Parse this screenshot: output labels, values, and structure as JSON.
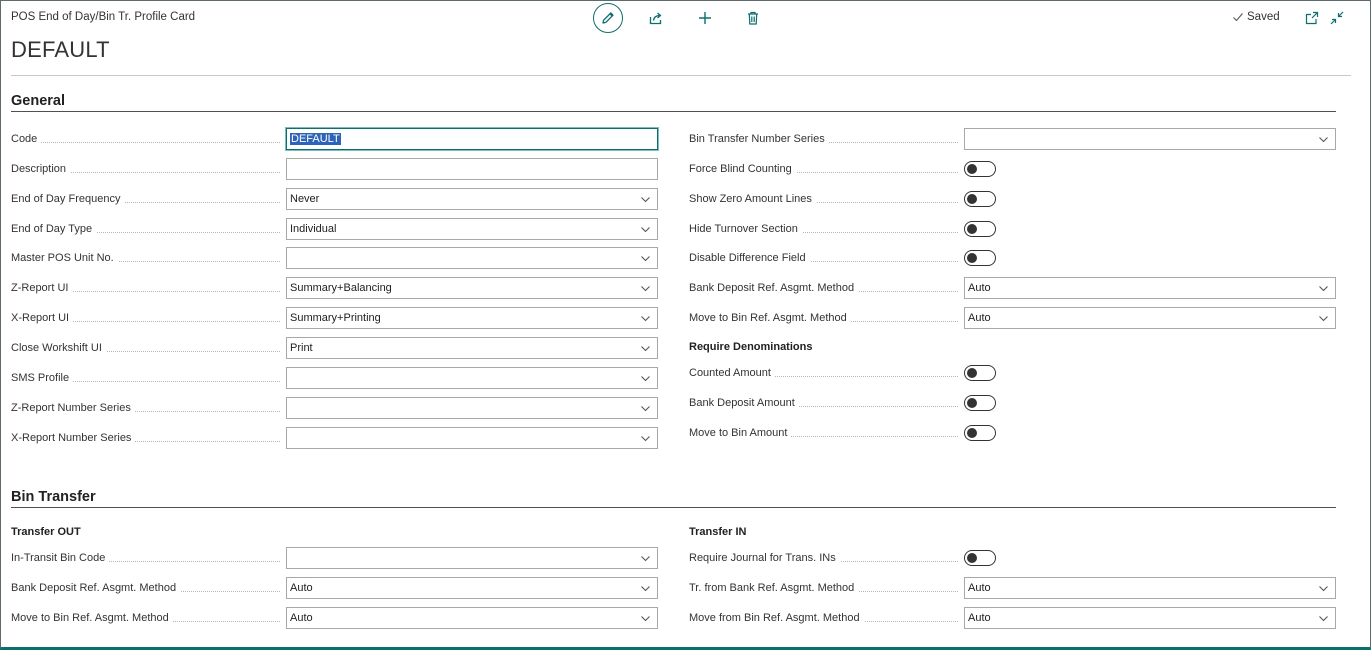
{
  "header": {
    "breadcrumb": "POS End of Day/Bin Tr. Profile Card",
    "title": "DEFAULT",
    "status": "Saved",
    "icon_color": "#0d6e6e"
  },
  "general": {
    "section_title": "General",
    "left": [
      {
        "label": "Code",
        "value": "DEFAULT",
        "kind": "text"
      },
      {
        "label": "Description",
        "value": "",
        "kind": "text"
      },
      {
        "label": "End of Day Frequency",
        "value": "Never",
        "kind": "select"
      },
      {
        "label": "End of Day Type",
        "value": "Individual",
        "kind": "select"
      },
      {
        "label": "Master POS Unit No.",
        "value": "",
        "kind": "select"
      },
      {
        "label": "Z-Report UI",
        "value": "Summary+Balancing",
        "kind": "select"
      },
      {
        "label": "X-Report UI",
        "value": "Summary+Printing",
        "kind": "select"
      },
      {
        "label": "Close Workshift UI",
        "value": "Print",
        "kind": "select"
      },
      {
        "label": "SMS Profile",
        "value": "",
        "kind": "select"
      },
      {
        "label": "Z-Report Number Series",
        "value": "",
        "kind": "select"
      },
      {
        "label": "X-Report Number Series",
        "value": "",
        "kind": "select"
      }
    ],
    "right": [
      {
        "label": "Bin Transfer Number Series",
        "value": "",
        "kind": "select"
      },
      {
        "label": "Force Blind Counting",
        "value": "off",
        "kind": "toggle"
      },
      {
        "label": "Show Zero Amount Lines",
        "value": "off",
        "kind": "toggle"
      },
      {
        "label": "Hide Turnover Section",
        "value": "off",
        "kind": "toggle"
      },
      {
        "label": "Disable Difference Field",
        "value": "off",
        "kind": "toggle"
      },
      {
        "label": "Bank Deposit Ref. Asgmt. Method",
        "value": "Auto",
        "kind": "select"
      },
      {
        "label": "Move to Bin Ref. Asgmt. Method",
        "value": "Auto",
        "kind": "select"
      }
    ],
    "denominations_title": "Require Denominations",
    "denominations": [
      {
        "label": "Counted Amount",
        "value": "off",
        "kind": "toggle"
      },
      {
        "label": "Bank Deposit Amount",
        "value": "off",
        "kind": "toggle"
      },
      {
        "label": "Move to Bin Amount",
        "value": "off",
        "kind": "toggle"
      }
    ]
  },
  "bin_transfer": {
    "section_title": "Bin Transfer",
    "out_title": "Transfer OUT",
    "out": [
      {
        "label": "In-Transit Bin Code",
        "value": "",
        "kind": "select"
      },
      {
        "label": "Bank Deposit Ref. Asgmt. Method",
        "value": "Auto",
        "kind": "select"
      },
      {
        "label": "Move to Bin Ref. Asgmt. Method",
        "value": "Auto",
        "kind": "select"
      }
    ],
    "in_title": "Transfer IN",
    "in": [
      {
        "label": "Require Journal for Trans. INs",
        "value": "off",
        "kind": "toggle"
      },
      {
        "label": "Tr. from Bank Ref. Asgmt. Method",
        "value": "Auto",
        "kind": "select"
      },
      {
        "label": "Move from Bin Ref. Asgmt. Method",
        "value": "Auto",
        "kind": "select"
      }
    ]
  }
}
